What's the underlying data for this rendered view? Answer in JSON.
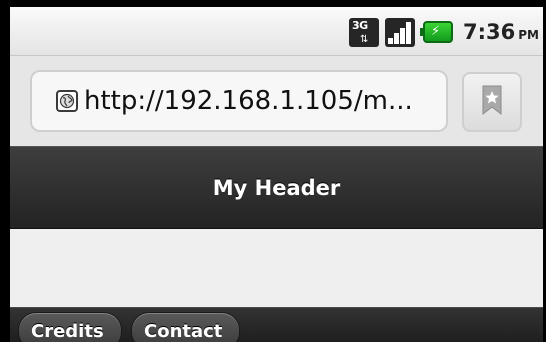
{
  "status_bar": {
    "network_type": "3G",
    "network_icon": "3g-data-icon",
    "signal_icon": "signal-strength-icon",
    "battery_icon": "battery-charging-icon",
    "time": "7:36",
    "ampm": "PM"
  },
  "browser": {
    "url": "http://192.168.1.105/m...",
    "site_icon": "globe-icon",
    "bookmark_icon": "bookmark-star-icon"
  },
  "page": {
    "header_title": "My Header",
    "footer_buttons": [
      {
        "label": "Credits"
      },
      {
        "label": "Contact"
      }
    ]
  },
  "colors": {
    "header_bg": "#2f2f2f",
    "battery_green": "#22b526"
  }
}
